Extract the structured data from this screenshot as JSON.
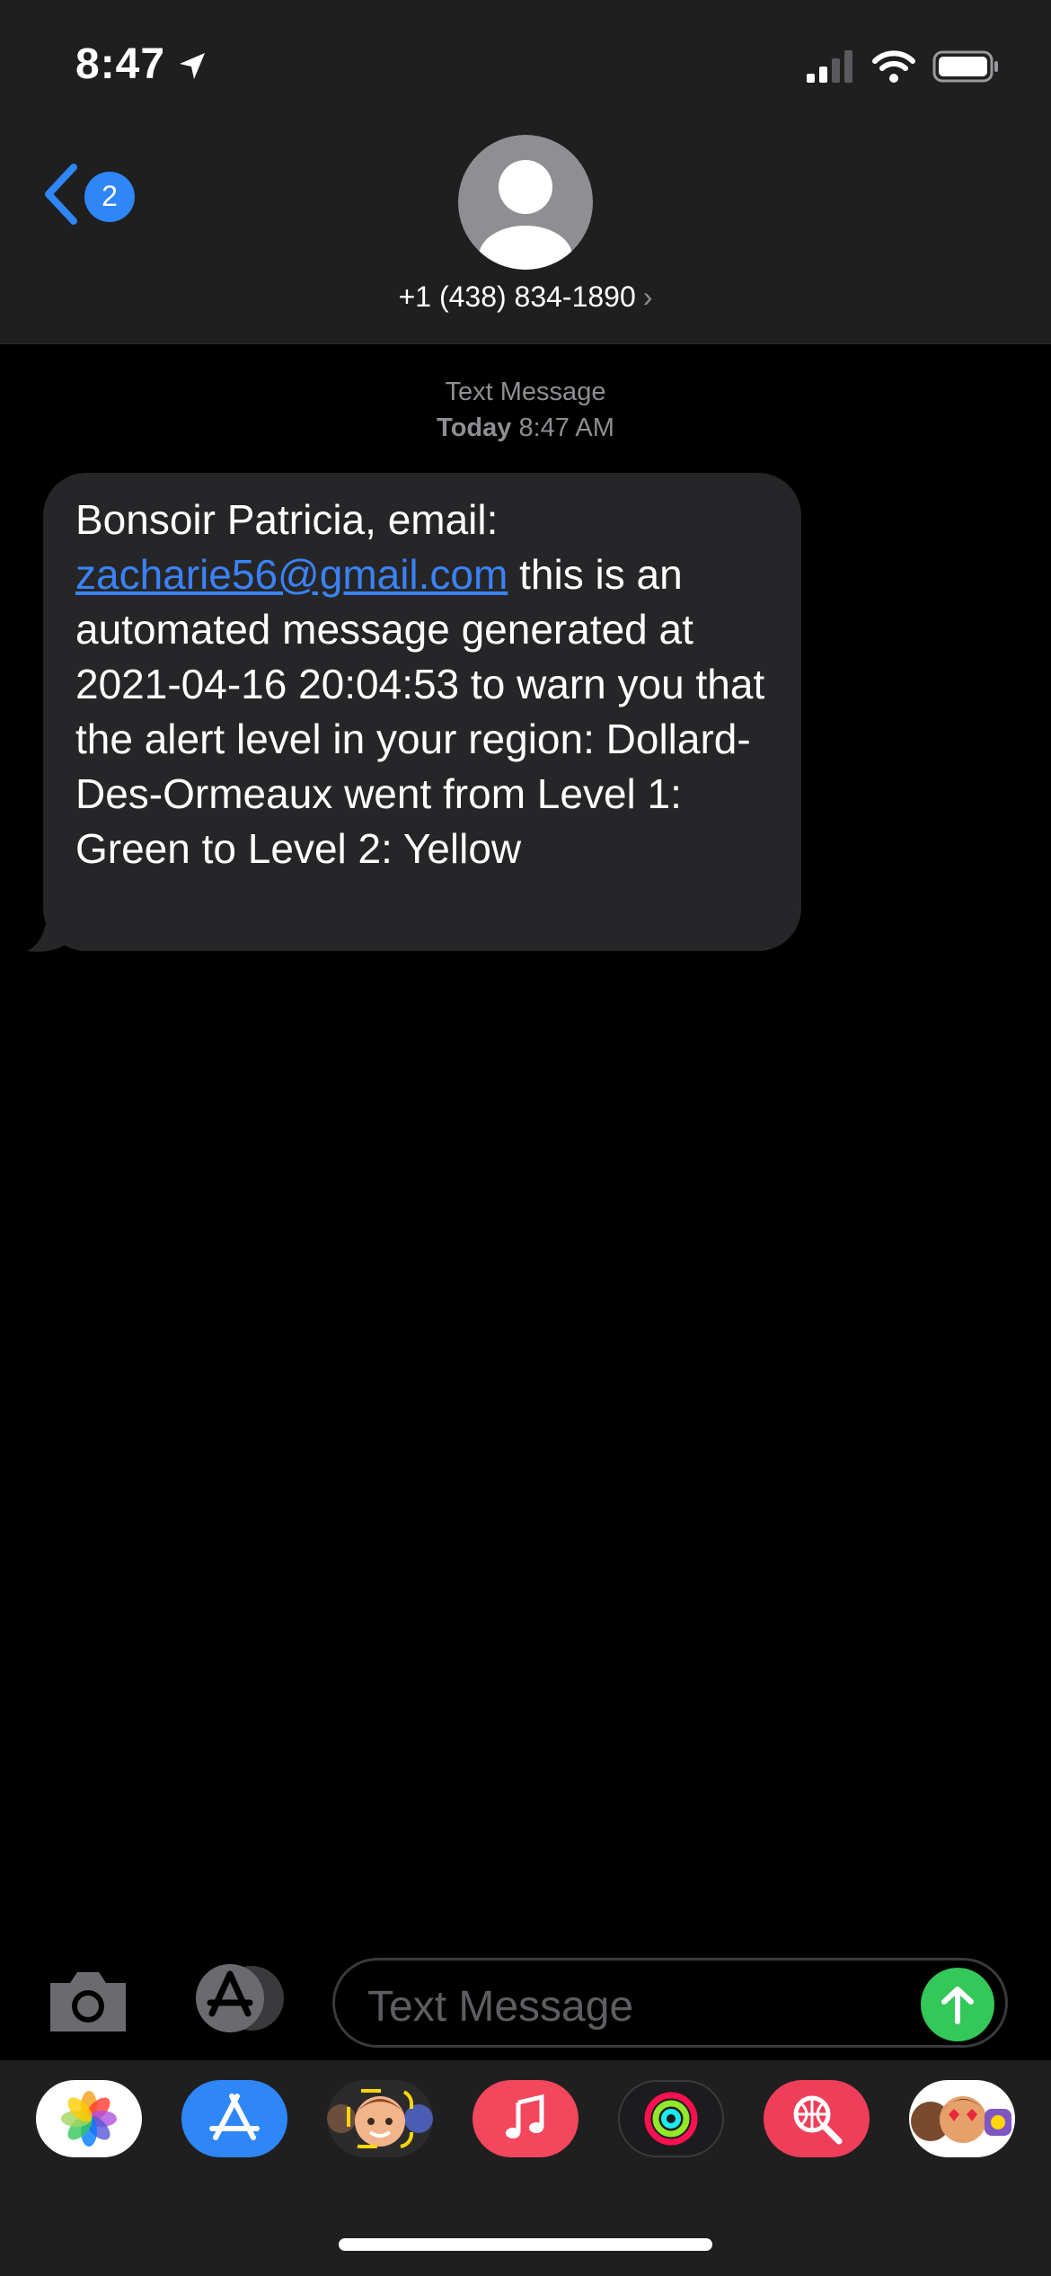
{
  "status_bar": {
    "time": "8:47",
    "icons": [
      "location-arrow-icon",
      "cellular-signal-icon",
      "wifi-icon",
      "battery-icon"
    ]
  },
  "header": {
    "back_badge": "2",
    "contact_number": "+1 (438) 834-1890",
    "chevron": "›"
  },
  "thread": {
    "service_label": "Text Message",
    "day": "Today",
    "time": "8:47 AM",
    "message": {
      "before_link": "Bonsoir Patricia, email: ",
      "link": "zacharie56@gmail.com",
      "after_link": " this is an automated message generated at 2021-04-16 20:04:53 to warn you that the alert level in your region: Dollard-Des-Ormeaux went from Level 1: Green to Level 2: Yellow"
    }
  },
  "composer": {
    "placeholder": "Text Message"
  },
  "app_tray": {
    "apps": [
      "photos-icon",
      "app-store-icon",
      "memoji-icon",
      "music-icon",
      "activity-icon",
      "images-search-icon",
      "stickers-icon"
    ]
  },
  "colors": {
    "accent_blue": "#2f86f6",
    "send_green": "#34c759",
    "bubble_gray": "#262628"
  }
}
